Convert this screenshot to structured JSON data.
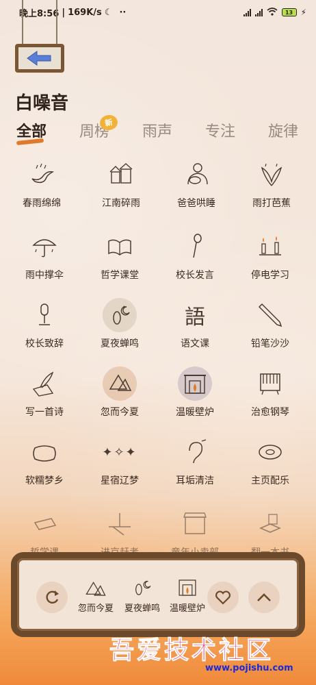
{
  "status_bar": {
    "time": "晚上8:56",
    "speed": "169K/s",
    "battery": "13"
  },
  "page": {
    "title": "白噪音"
  },
  "tabs": [
    {
      "label": "全部",
      "active": true
    },
    {
      "label": "周榜",
      "active": false,
      "badge": "新"
    },
    {
      "label": "雨声",
      "active": false
    },
    {
      "label": "专注",
      "active": false
    },
    {
      "label": "旋律",
      "active": false
    }
  ],
  "grid": [
    {
      "label": "春雨绵绵",
      "icon": "swallow-rain-icon"
    },
    {
      "label": "江南碎雨",
      "icon": "town-rain-icon"
    },
    {
      "label": "爸爸哄睡",
      "icon": "father-baby-icon"
    },
    {
      "label": "雨打芭蕉",
      "icon": "banana-leaf-icon"
    },
    {
      "label": "雨中撑伞",
      "icon": "umbrella-icon"
    },
    {
      "label": "哲学课堂",
      "icon": "open-book-icon"
    },
    {
      "label": "校长发言",
      "icon": "microphone-icon"
    },
    {
      "label": "停电学习",
      "icon": "candles-icon"
    },
    {
      "label": "校长致辞",
      "icon": "desk-mic-icon"
    },
    {
      "label": "夏夜蝉鸣",
      "icon": "cicada-moon-icon"
    },
    {
      "label": "语文课",
      "icon": "chinese-char-icon"
    },
    {
      "label": "铅笔沙沙",
      "icon": "pencil-icon"
    },
    {
      "label": "写一首诗",
      "icon": "quill-paper-icon"
    },
    {
      "label": "忽而今夏",
      "icon": "watermelon-icon"
    },
    {
      "label": "温暖壁炉",
      "icon": "fireplace-icon"
    },
    {
      "label": "治愈钢琴",
      "icon": "piano-icon"
    },
    {
      "label": "软糯梦乡",
      "icon": "pillow-icon"
    },
    {
      "label": "星宿辽梦",
      "icon": "stars-icon"
    },
    {
      "label": "耳垢清洁",
      "icon": "ear-icon"
    },
    {
      "label": "主页配乐",
      "icon": "vinyl-icon"
    },
    {
      "label": "哲学课",
      "icon": "closed-book-icon"
    },
    {
      "label": "进京赶考",
      "icon": "road-icon"
    },
    {
      "label": "童年小卖部",
      "icon": "shop-icon"
    },
    {
      "label": "翻一本书",
      "icon": "reading-book-icon"
    }
  ],
  "player": {
    "playing": [
      {
        "label": "忽而今夏",
        "icon": "watermelon-icon"
      },
      {
        "label": "夏夜蝉鸣",
        "icon": "cicada-moon-icon"
      },
      {
        "label": "温暖壁炉",
        "icon": "fireplace-icon"
      }
    ]
  },
  "watermark": {
    "text": "吾爱技术社区",
    "url": "www.pojishu.com"
  },
  "colors": {
    "accent": "#e07a2a",
    "wood": "#6b4a2c",
    "text": "#3b2a20"
  }
}
